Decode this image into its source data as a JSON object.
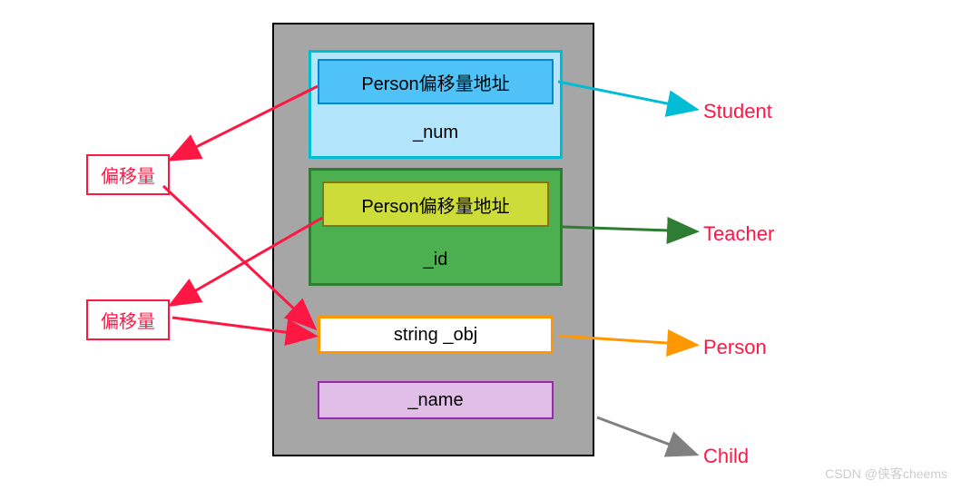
{
  "main_container": {
    "student": {
      "inner_label": "Person偏移量地址",
      "member": "_num"
    },
    "teacher": {
      "inner_label": "Person偏移量地址",
      "member": "_id"
    },
    "person": {
      "member": "string _obj"
    },
    "child": {
      "member": "_name"
    }
  },
  "offset_labels": {
    "label1": "偏移量",
    "label2": "偏移量"
  },
  "class_labels": {
    "student": "Student",
    "teacher": "Teacher",
    "person": "Person",
    "child": "Child"
  },
  "watermark": "CSDN @侠客cheems",
  "colors": {
    "container_bg": "#a6a6a6",
    "student_border": "#00bcd4",
    "student_bg": "#b3e5fc",
    "teacher_bg": "#4caf50",
    "teacher_inner_bg": "#cddc39",
    "person_border": "#ff9800",
    "child_bg": "#e1bee7",
    "label_color": "#ff1744",
    "arrow_cyan": "#00bcd4",
    "arrow_green": "#2e7d32",
    "arrow_orange": "#ff9800",
    "arrow_gray": "#808080",
    "arrow_red": "#ff1744"
  }
}
